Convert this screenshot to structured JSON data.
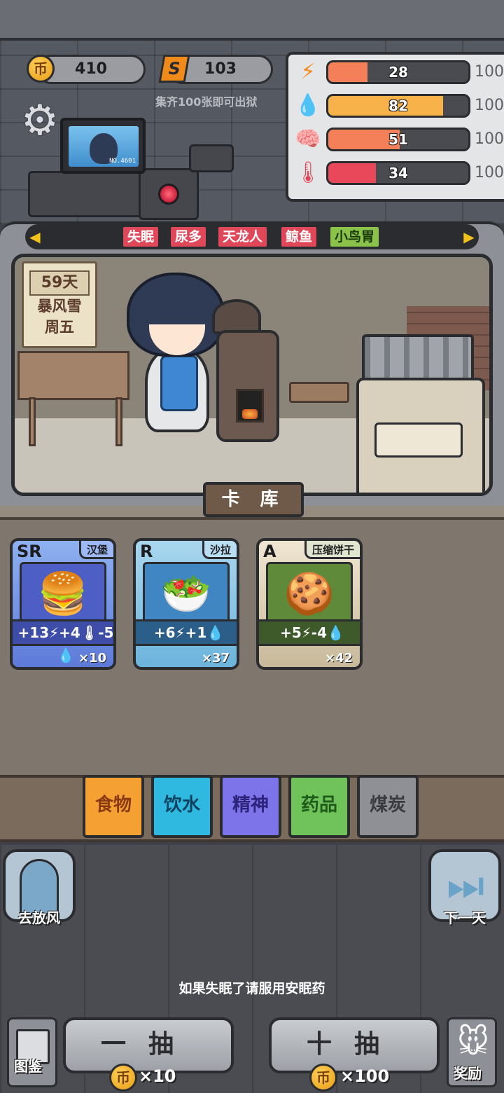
{
  "currencies": {
    "coins": "410",
    "coin_icon": "币",
    "scrap": "103",
    "scrap_icon": "S"
  },
  "hint_collect": "集齐100张即可出狱",
  "monitor_label": "NO.4601",
  "stats": [
    {
      "icon": "lightning-icon",
      "glyph": "⚡",
      "value": "28",
      "max": "100",
      "fraction": 0.28,
      "color": "#f4805a"
    },
    {
      "icon": "water-drop-icon",
      "glyph": "💧",
      "value": "82",
      "max": "100",
      "fraction": 0.82,
      "color": "#f7b34a"
    },
    {
      "icon": "brain-icon",
      "glyph": "🧠",
      "value": "51",
      "max": "100",
      "fraction": 0.51,
      "color": "#f4805a"
    },
    {
      "icon": "thermometer-icon",
      "glyph": "🌡",
      "value": "34",
      "max": "100",
      "fraction": 0.34,
      "color": "#e8485a"
    }
  ],
  "traits": [
    {
      "label": "失眠",
      "color": "red"
    },
    {
      "label": "尿多",
      "color": "red"
    },
    {
      "label": "天龙人",
      "color": "red"
    },
    {
      "label": "鲸鱼",
      "color": "red"
    },
    {
      "label": "小鸟胃",
      "color": "green"
    }
  ],
  "calendar": {
    "day": "59天",
    "weather": "暴风雪",
    "weekday": "周五"
  },
  "card_library_label": "卡 库",
  "cards": [
    {
      "rank": "SR",
      "name": "汉堡",
      "effect": "+13⚡+4🌡-5💧",
      "count": "×10",
      "emoji": "🍔",
      "effect_bg": "#3e4ea8"
    },
    {
      "rank": "R",
      "name": "沙拉",
      "effect": "+6⚡+1💧",
      "count": "×37",
      "emoji": "🥗",
      "effect_bg": "#2b5f8a"
    },
    {
      "rank": "A",
      "name": "压缩饼干",
      "effect": "+5⚡-4💧",
      "count": "×42",
      "emoji": "🍪",
      "effect_bg": "#3f5a2a"
    }
  ],
  "categories": [
    {
      "label": "食物",
      "active": true
    },
    {
      "label": "饮水",
      "active": false
    },
    {
      "label": "精神",
      "active": false
    },
    {
      "label": "药品",
      "active": false
    },
    {
      "label": "煤炭",
      "active": false
    }
  ],
  "buttons": {
    "go_out": "去放风",
    "next_day": "下一天",
    "catalog": "图鉴",
    "reward": "奖励",
    "draw_one": "一抽",
    "draw_one_cost": "×10",
    "draw_ten": "十抽",
    "draw_ten_cost": "×100"
  },
  "hint_bottom": "如果失眠了请服用安眠药"
}
